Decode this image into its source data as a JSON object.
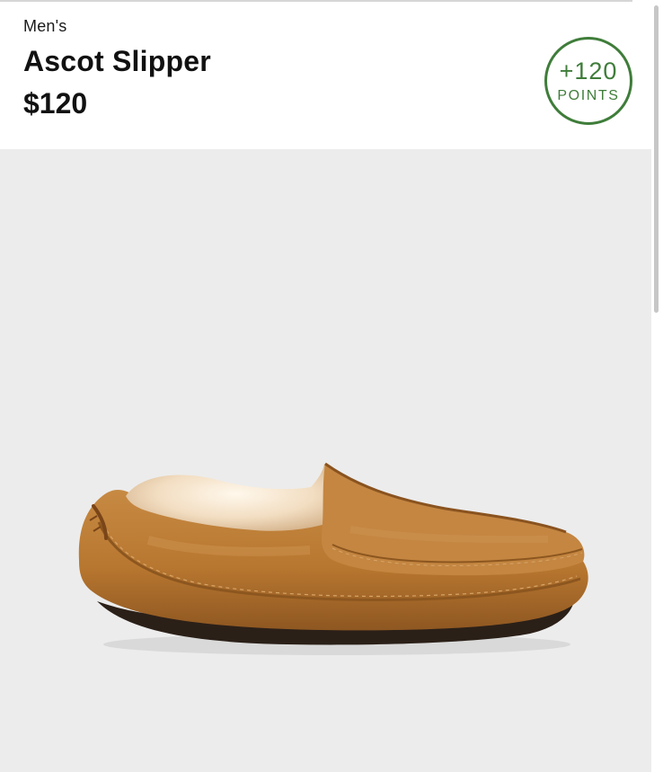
{
  "product": {
    "category": "Men's",
    "name": "Ascot Slipper",
    "price": "$120"
  },
  "rewards": {
    "points": "+120",
    "label": "POINTS",
    "color": "#3f7d3a"
  },
  "image": {
    "description_icon": "slipper-image",
    "background": "#ececec"
  }
}
